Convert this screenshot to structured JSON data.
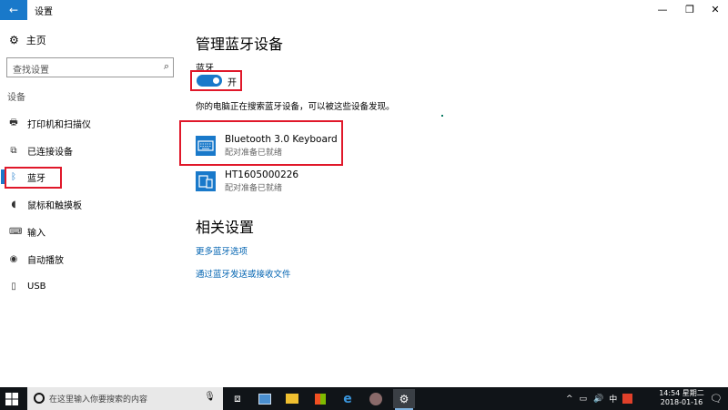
{
  "window": {
    "title": "设置",
    "minimize": "—",
    "maximize": "❐",
    "close": "✕"
  },
  "sidebar": {
    "home_label": "主页",
    "search_placeholder": "查找设置",
    "section_label": "设备",
    "items": [
      {
        "label": "打印机和扫描仪",
        "icon": "printer-icon"
      },
      {
        "label": "已连接设备",
        "icon": "connected-devices-icon"
      },
      {
        "label": "蓝牙",
        "icon": "bluetooth-icon",
        "active": true
      },
      {
        "label": "鼠标和触摸板",
        "icon": "mouse-icon"
      },
      {
        "label": "输入",
        "icon": "keyboard-icon"
      },
      {
        "label": "自动播放",
        "icon": "autoplay-icon"
      },
      {
        "label": "USB",
        "icon": "usb-icon"
      }
    ]
  },
  "main": {
    "title": "管理蓝牙设备",
    "bluetooth_label": "蓝牙",
    "toggle_state": "开",
    "description": "你的电脑正在搜索蓝牙设备，可以被这些设备发现。",
    "devices": [
      {
        "name": "Bluetooth 3.0 Keyboard",
        "status": "配对准备已就绪",
        "icon": "keyboard-device-icon"
      },
      {
        "name": "HT1605000226",
        "status": "配对准备已就绪",
        "icon": "phone-device-icon"
      }
    ],
    "related_title": "相关设置",
    "links": [
      "更多蓝牙选项",
      "通过蓝牙发送或接收文件"
    ]
  },
  "taskbar": {
    "search_placeholder": "在这里输入你要搜索的内容",
    "time": "14:54 星期二",
    "date": "2018-01-16",
    "ime": "中",
    "colors": {
      "accent": "#1979ca",
      "taskbar": "#101418",
      "highlight": "#e0182a"
    }
  }
}
